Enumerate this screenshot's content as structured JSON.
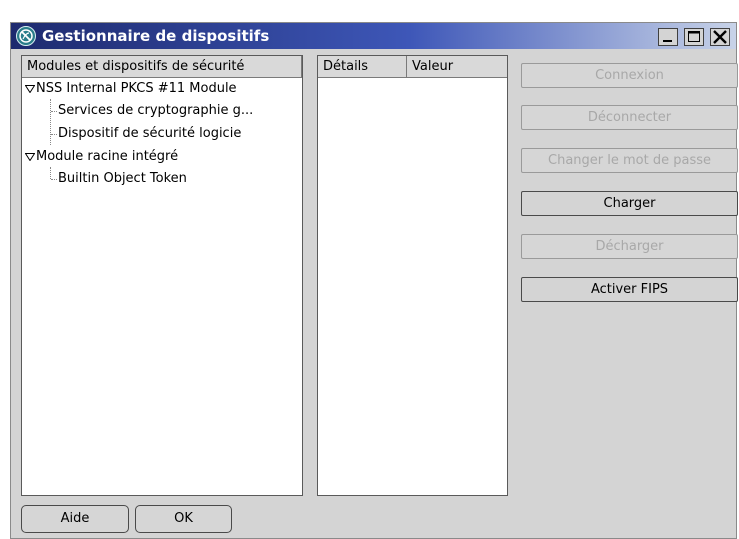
{
  "window": {
    "title": "Gestionnaire de dispositifs"
  },
  "tree": {
    "column_header": "Modules et dispositifs de sécurité",
    "items": [
      {
        "label": "NSS Internal PKCS #11 Module"
      },
      {
        "label": "Services de cryptographie g..."
      },
      {
        "label": "Dispositif de sécurité logicie"
      },
      {
        "label": "Module racine intégré"
      },
      {
        "label": "Builtin Object Token"
      }
    ]
  },
  "details": {
    "col_details": "Détails",
    "col_value": "Valeur"
  },
  "actions": {
    "connect": "Connexion",
    "disconnect": "Déconnecter",
    "change_password": "Changer le mot de passe",
    "load": "Charger",
    "unload": "Décharger",
    "enable_fips": "Activer FIPS"
  },
  "footer": {
    "help": "Aide",
    "ok": "OK"
  },
  "colors": {
    "title_start": "#1d2a6e",
    "title_end": "#c8d3e8",
    "window_bg": "#d4d4d4",
    "disabled_text": "#a8a8a8"
  },
  "icons": {
    "app": "nss-globe-icon",
    "minimize": "minimize-icon",
    "maximize": "maximize-icon",
    "close": "close-icon",
    "expanded": "triangle-down-icon"
  }
}
